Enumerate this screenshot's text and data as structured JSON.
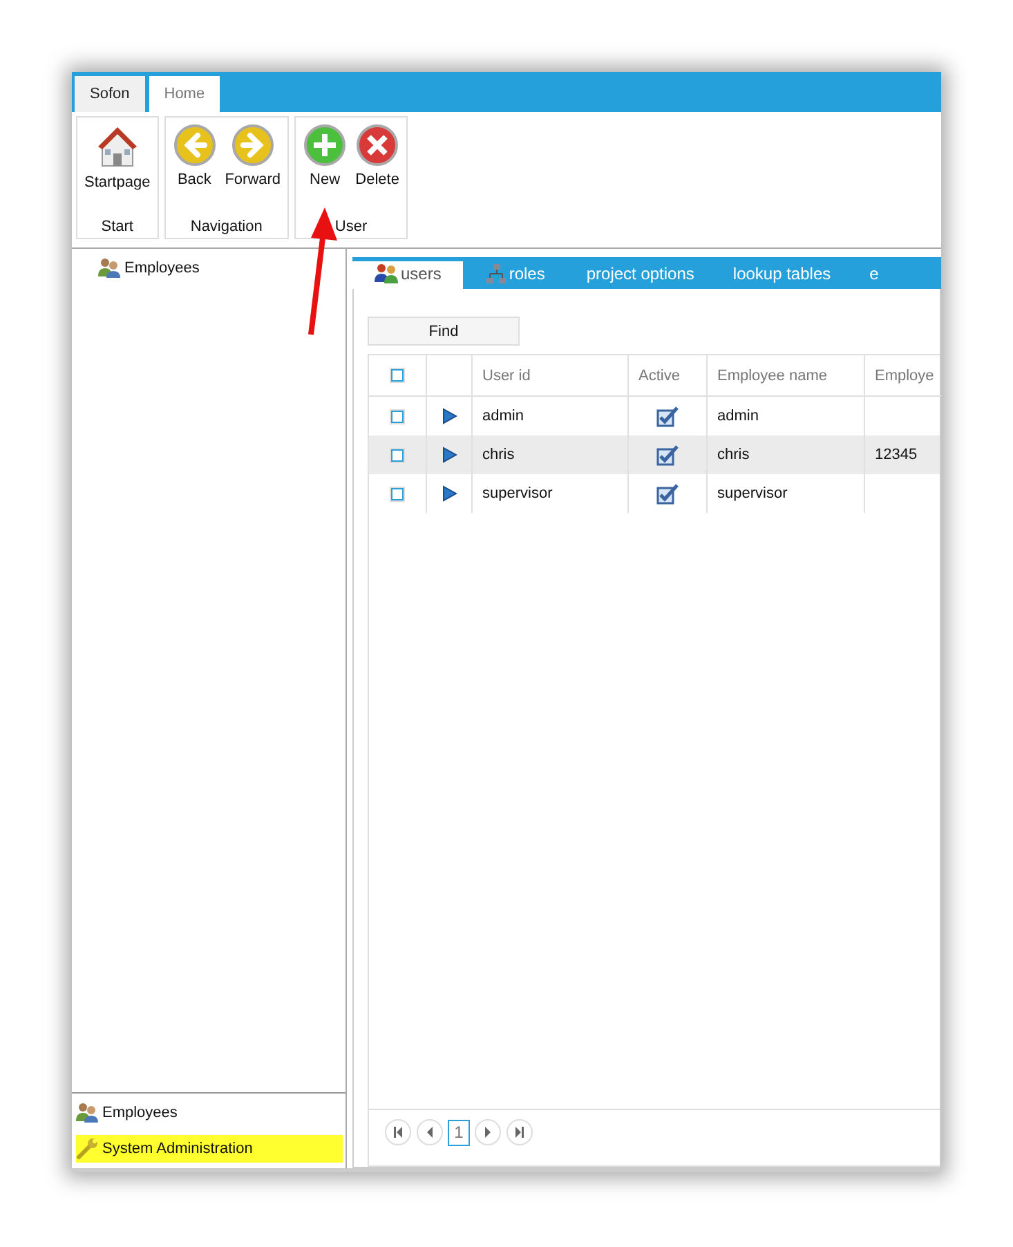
{
  "ribbon": {
    "tabs": [
      {
        "label": "Sofon",
        "selected": false
      },
      {
        "label": "Home",
        "selected": true
      }
    ],
    "groups": [
      {
        "label": "Start",
        "buttons": [
          {
            "label": "Startpage",
            "kind": "home"
          }
        ]
      },
      {
        "label": "Navigation",
        "buttons": [
          {
            "label": "Back",
            "kind": "back"
          },
          {
            "label": "Forward",
            "kind": "forward"
          }
        ]
      },
      {
        "label": "User",
        "buttons": [
          {
            "label": "New",
            "kind": "new"
          },
          {
            "label": "Delete",
            "kind": "delete"
          }
        ]
      }
    ]
  },
  "tree": {
    "items": [
      {
        "label": "Employees",
        "kind": "employees"
      }
    ]
  },
  "navigation": {
    "items": [
      {
        "label": "Employees",
        "kind": "employees",
        "highlighted": false
      },
      {
        "label": "System Administration",
        "kind": "admin",
        "highlighted": true
      }
    ]
  },
  "content_tabs": [
    {
      "label": "users",
      "kind": "users",
      "selected": true
    },
    {
      "label": "roles",
      "kind": "roles",
      "selected": false
    },
    {
      "label": "project options",
      "selected": false
    },
    {
      "label": "lookup tables",
      "selected": false
    },
    {
      "label": "e",
      "selected": false
    }
  ],
  "find_button": "Find",
  "grid": {
    "select_all": {
      "checked": false
    },
    "columns": [
      "User id",
      "Active",
      "Employee name",
      "Employe"
    ],
    "rows": [
      {
        "checked": false,
        "selected": false,
        "user_id": "admin",
        "active": true,
        "employee_name": "admin"
      },
      {
        "checked": false,
        "selected": true,
        "user_id": "chris",
        "active": true,
        "employee_name": "chris",
        "column_4": "12345"
      },
      {
        "checked": false,
        "selected": false,
        "user_id": "supervisor",
        "active": true,
        "employee_name": "supervisor"
      }
    ]
  },
  "pager": {
    "pages": [
      {
        "label": "1",
        "selected": true
      }
    ]
  },
  "annotation": {
    "kind": "arrow"
  }
}
